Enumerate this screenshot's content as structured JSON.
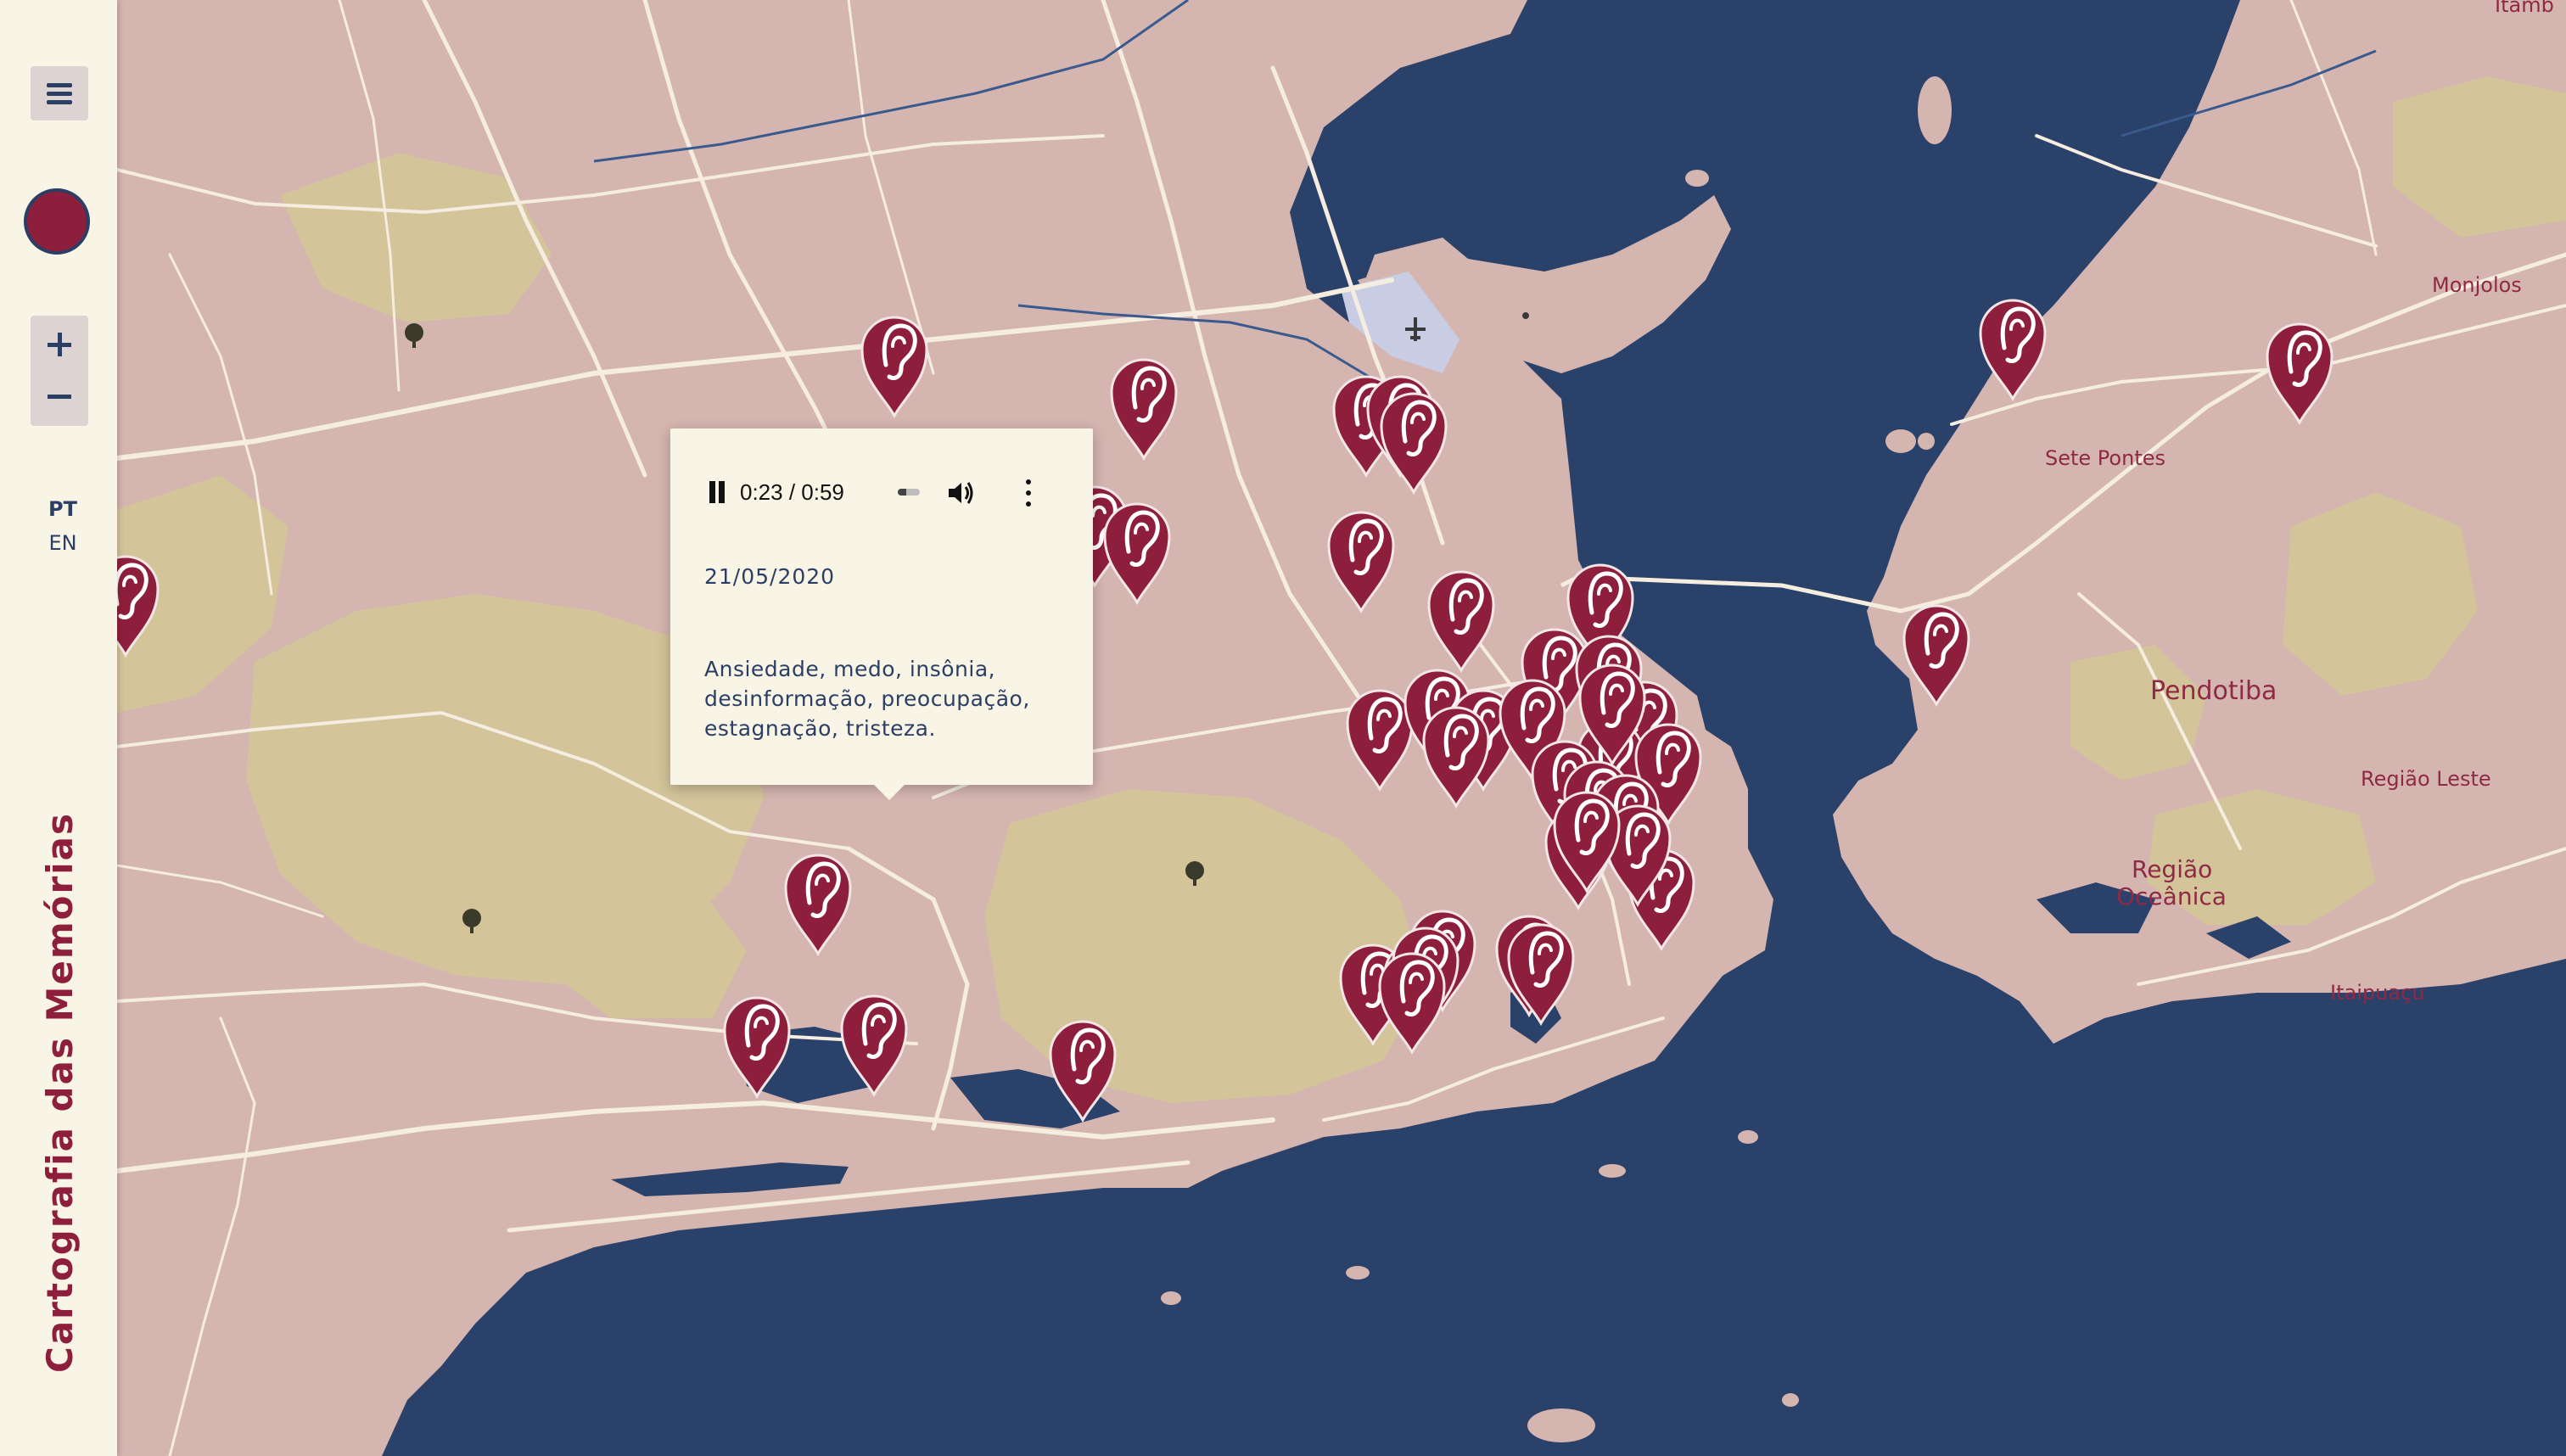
{
  "site": {
    "title": "Cartografia das Memórias"
  },
  "sidebar": {
    "menu_icon": "hamburger-icon",
    "record_icon": "record-dot-icon",
    "zoom_in_icon": "plus-icon",
    "zoom_out_icon": "minus-icon",
    "languages": [
      {
        "code": "PT",
        "active": true
      },
      {
        "code": "EN",
        "active": false
      }
    ]
  },
  "popup": {
    "audio": {
      "time": "0:23 / 0:59",
      "progress": 0.39
    },
    "date": "21/05/2020",
    "text": "Ansiedade, medo, insônia, desinformação, preocupação, estagnação, tristeza."
  },
  "map": {
    "marker_icon": "ear-icon",
    "marker_count": 44,
    "colors": {
      "water": "#2a416a",
      "land": "#d5b5b0",
      "green": "#d3c49a",
      "marker": "#8e1f3c",
      "roads": "#f5ede0"
    },
    "place_labels": [
      "Monjolos",
      "Sete Pontes",
      "Pendotiba",
      "Região Leste",
      "Região",
      "Oceânica",
      "Itaipuaçu",
      "Itamb"
    ]
  }
}
